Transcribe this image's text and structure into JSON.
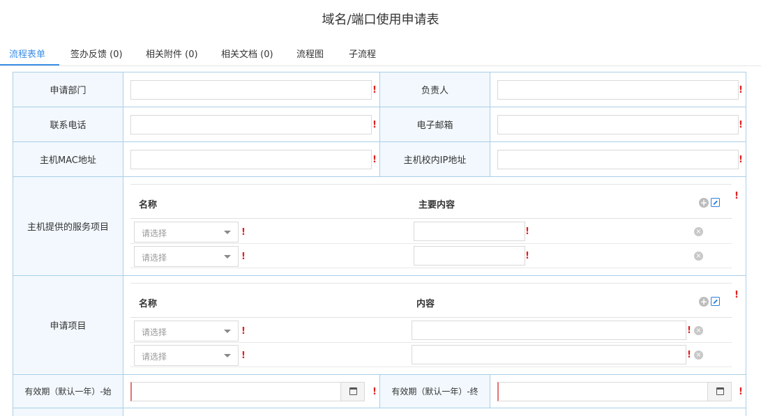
{
  "page_title": "域名/端口使用申请表",
  "tabs": [
    "流程表单",
    "签办反馈 (0)",
    "相关附件 (0)",
    "相关文档 (0)",
    "流程图",
    "子流程"
  ],
  "form": {
    "department_label": "申请部门",
    "owner_label": "负责人",
    "phone_label": "联系电话",
    "email_label": "电子邮箱",
    "mac_label": "主机MAC地址",
    "ip_label": "主机校内IP地址",
    "services_label": "主机提供的服务项目",
    "items_label": "申请项目",
    "valid_start_label": "有效期（默认一年）-始",
    "valid_end_label": "有效期（默认一年）-终",
    "required_mark": "!"
  },
  "services_table": {
    "col_name": "名称",
    "col_content": "主要内容",
    "rows": [
      {
        "name_placeholder": "请选择",
        "content": ""
      },
      {
        "name_placeholder": "请选择",
        "content": ""
      }
    ]
  },
  "items_table": {
    "col_name": "名称",
    "col_content": "内容",
    "rows": [
      {
        "name_placeholder": "请选择",
        "content": ""
      },
      {
        "name_placeholder": "请选择",
        "content": ""
      }
    ]
  },
  "icons": {
    "add": "plus-circle-icon",
    "export": "export-icon",
    "remove": "close-circle-icon",
    "calendar": "calendar-icon",
    "dropdown": "chevron-down-icon"
  },
  "colors": {
    "accent": "#3a8ee6",
    "label_bg": "#f2f8fd",
    "border": "#a9cfe8",
    "required": "#e02020"
  }
}
